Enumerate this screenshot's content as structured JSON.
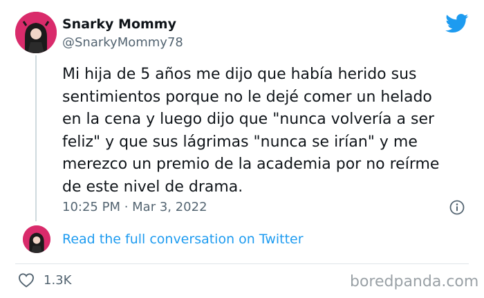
{
  "tweet": {
    "author_name": "Snarky Mommy",
    "author_handle": "@SnarkyMommy78",
    "text": "Mi hija de 5 años me dijo que había herido sus\nsentimientos porque no le dejé comer un helado\nen la cena y luego dijo que \"nunca volvería a ser\nfeliz\" y que sus lágrimas \"nunca se irían\" y me\nmerezco un premio de la academia por no reírme\nde este nivel de drama.",
    "timestamp": "10:25 PM · Mar 3, 2022",
    "read_full_label": "Read the full conversation on Twitter",
    "like_count": "1.3K"
  },
  "watermark": "boredpanda.com",
  "icons": {
    "brand": "twitter-bird-icon",
    "info": "info-icon",
    "like": "heart-icon"
  },
  "colors": {
    "link": "#1d9bf0",
    "avatar_bg": "#d92b6b",
    "muted_text": "#536471"
  }
}
